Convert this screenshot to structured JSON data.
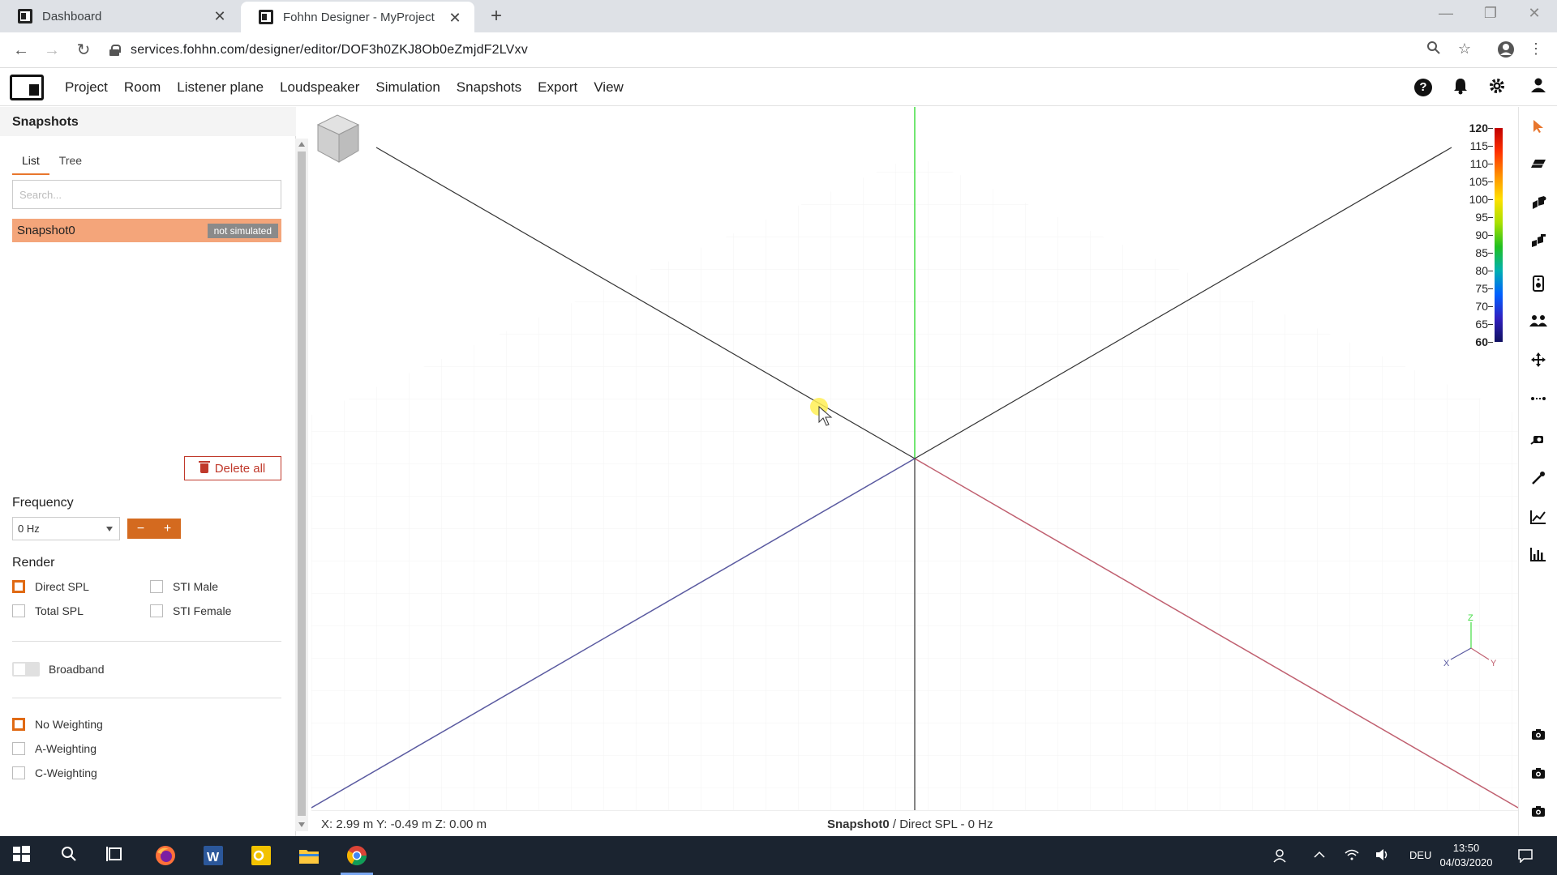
{
  "browser": {
    "tabs": [
      {
        "title": "Dashboard",
        "active": false
      },
      {
        "title": "Fohhn Designer - MyProject",
        "active": true
      }
    ],
    "url": "services.fohhn.com/designer/editor/DOF3h0ZKJ8Ob0eZmjdF2LVxv"
  },
  "menu": {
    "items": [
      "Project",
      "Room",
      "Listener plane",
      "Loudspeaker",
      "Simulation",
      "Snapshots",
      "Export",
      "View"
    ]
  },
  "sidebar": {
    "title": "Snapshots",
    "tabs": [
      "List",
      "Tree"
    ],
    "active_tab": "List",
    "search_placeholder": "Search...",
    "snapshots": [
      {
        "name": "Snapshot0",
        "status": "not simulated"
      }
    ],
    "delete_all_label": "Delete all",
    "frequency_label": "Frequency",
    "frequency_value": "0 Hz",
    "render_label": "Render",
    "render_options": [
      {
        "label": "Direct SPL",
        "checked": true
      },
      {
        "label": "STI Male",
        "checked": false
      },
      {
        "label": "Total SPL",
        "checked": false
      },
      {
        "label": "STI Female",
        "checked": false
      }
    ],
    "broadband_label": "Broadband",
    "broadband_on": false,
    "weighting_options": [
      {
        "label": "No Weighting",
        "checked": true
      },
      {
        "label": "A-Weighting",
        "checked": false
      },
      {
        "label": "C-Weighting",
        "checked": false
      }
    ]
  },
  "viewport": {
    "coords": "X: 2.99 m Y: -0.49 m Z: 0.00 m",
    "snapshot_name": "Snapshot0",
    "status_suffix": "/ Direct SPL - 0 Hz",
    "colorbar_labels": [
      "120",
      "115",
      "110",
      "105",
      "100",
      "95",
      "90",
      "85",
      "80",
      "75",
      "70",
      "65",
      "60"
    ],
    "axis_labels": {
      "x": "X",
      "y": "Y",
      "z": "Z"
    }
  },
  "colors": {
    "accent": "#e8762d",
    "snapshot_row": "#f4a57a",
    "axis_x": "#c06070",
    "axis_y": "#5a5aa0",
    "axis_z": "#44dd44"
  },
  "taskbar": {
    "language": "DEU",
    "time": "13:50",
    "date": "04/03/2020"
  }
}
